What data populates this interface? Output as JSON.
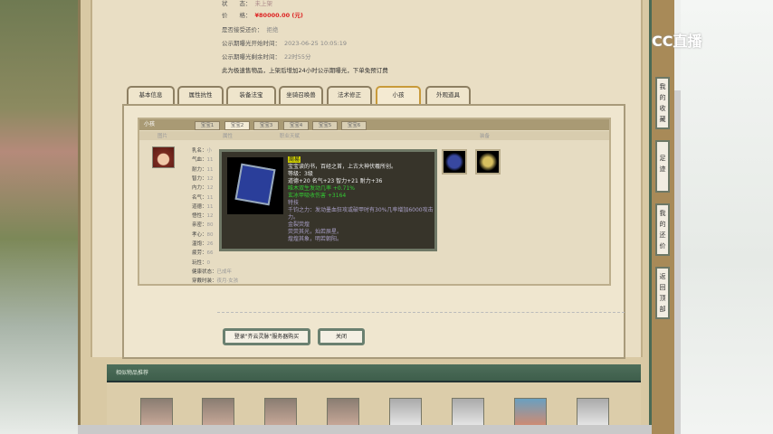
{
  "info": {
    "row0": {
      "label": "状　　态：",
      "value": "未上架"
    },
    "price": {
      "label": "价　　格：",
      "value": "¥80000.00 (元)"
    },
    "bargain": {
      "label": "是否接受还价：",
      "value": "拒绝"
    },
    "start": {
      "label": "公示期曝光开始时间：",
      "value": "2023-06-25 10:05:19"
    },
    "remain": {
      "label": "公示期曝光剩余时间：",
      "value": "22时55分"
    },
    "notice": "此为极速售物品，上架后增加24小时公示期曝光，下单免预订费"
  },
  "tabs": [
    "基本信息",
    "属性抗性",
    "装备法宝",
    "坐骑召唤兽",
    "法术修正",
    "小孩",
    "外观道具"
  ],
  "panel": {
    "title": "小孩",
    "subtabs": [
      "宝宝1",
      "宝宝2",
      "宝宝3",
      "宝宝4",
      "宝宝5",
      "宝宝6"
    ],
    "headers": [
      "图片",
      "属性",
      "职业天赋",
      "装备"
    ]
  },
  "stats": [
    [
      "乳名：",
      "小"
    ],
    [
      "气血：",
      "11"
    ],
    [
      "耐力：",
      "11"
    ],
    [
      "智力：",
      "12"
    ],
    [
      "内力：",
      "12"
    ],
    [
      "名气：",
      "11"
    ],
    [
      "道德：",
      "11"
    ],
    [
      "悟性：",
      "12"
    ],
    [
      "亲密：",
      "80"
    ],
    [
      "孝心：",
      "80"
    ],
    [
      "温饱：",
      "26"
    ],
    [
      "疲劳：",
      "66"
    ],
    [
      "玩性：",
      "0"
    ],
    [
      "健康状态：",
      "已成年"
    ],
    [
      "穿戴时装：",
      "夜月·女孩"
    ]
  ],
  "tooltip": {
    "name": "周易",
    "desc": "宝宝读的书，百经之首，上古大神伏羲所创。",
    "level": "等级：3级",
    "attrs": "道德+20 名气+23 智力+21 耐力+36",
    "green1": "唯木双生发动几率 +0.71%",
    "green2": "玄冰甲吸收伤害 +3164",
    "skill_title": "特技",
    "skill": "千钧之力：发动墨血狂攻或破甲时有30%几率增加6000攻击力。",
    "set_title": "金裂荧煌",
    "set1": "荧荧其光，灿若辰星。",
    "set2": "煌煌其象，明若朝阳。"
  },
  "buttons": {
    "login": "登录\"齐云灵脉\"服务器购买",
    "close": "关闭"
  },
  "recommend": {
    "title": "相似物品推荐"
  },
  "sidebar": [
    "我的收藏",
    "足迹",
    "我的还价",
    "返回顶部"
  ],
  "logo": "CC直播",
  "colors": {
    "price": "#d22",
    "green": "#3c3",
    "tooltip_name": "#ff0"
  }
}
